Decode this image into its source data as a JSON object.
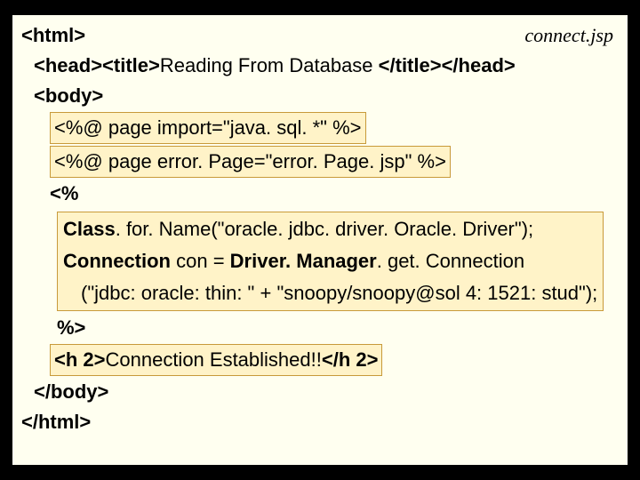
{
  "filename": "connect.jsp",
  "lines": {
    "l1": {
      "open": "<html>"
    },
    "l2": {
      "open": "<head><title>",
      "text": "Reading From Database ",
      "close": "</title></head>"
    },
    "l3": {
      "open": "<body>"
    },
    "l4": {
      "text": "<%@ page import=\"java. sql. *\" %>"
    },
    "l5": {
      "text": "<%@ page error. Page=\"error. Page. jsp\" %>"
    },
    "l6": {
      "open": "<%"
    },
    "block1": {
      "a": {
        "bold1": "Class",
        "rest1": ". for. Name(\"oracle. jdbc. driver. Oracle. Driver\");"
      },
      "b": {
        "bold1": "Connection",
        "mid": " con = ",
        "bold2": "Driver. Manager",
        "rest2": ". get. Connection"
      },
      "c": {
        "text": "(\"jdbc: oracle: thin: \" + \"snoopy/snoopy@sol 4: 1521: stud\");"
      }
    },
    "l7": {
      "close": "%>"
    },
    "l8": {
      "open": "<h 2>",
      "text": "Connection Established!!",
      "close": "</h 2>"
    },
    "l9": {
      "close": "</body>"
    },
    "l10": {
      "close": "</html>"
    }
  }
}
